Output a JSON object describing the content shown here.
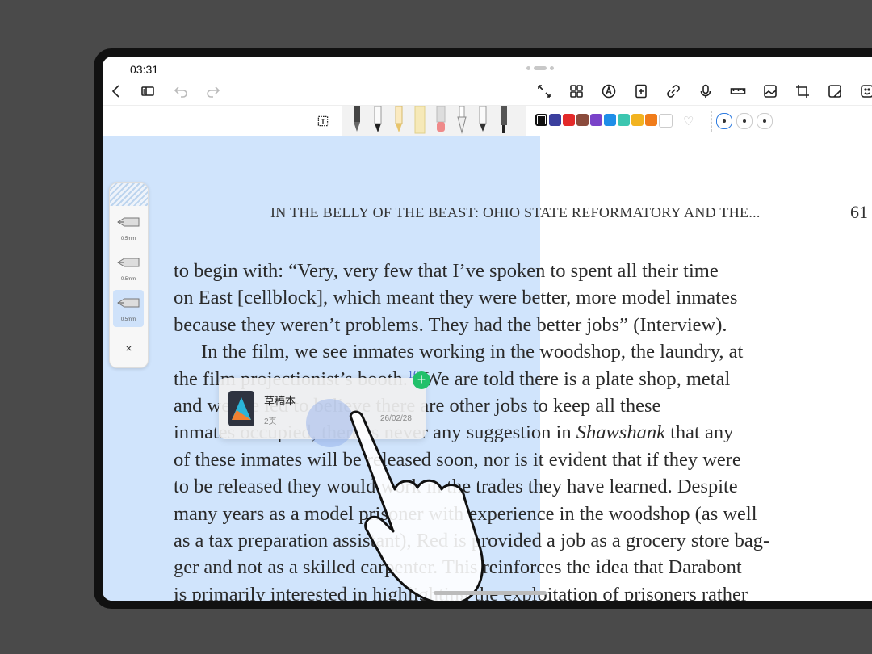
{
  "status": {
    "time": "03:31"
  },
  "topbar": {
    "icons": [
      "back-icon",
      "sidebar-icon",
      "undo-icon",
      "redo-icon",
      "expand-icon",
      "grid-icon",
      "pen-nib-icon",
      "add-page-icon",
      "link-icon",
      "microphone-icon",
      "ruler-icon",
      "image-icon",
      "crop-icon",
      "sticker-icon",
      "emoji-icon"
    ]
  },
  "toolbar": {
    "text_tool_icon": "text-box-icon",
    "tools": [
      "fountain-pen",
      "ballpoint-pen",
      "pencil",
      "highlighter",
      "eraser",
      "brush",
      "marker",
      "fineliner"
    ],
    "colors": [
      "#111111",
      "#3b3f9e",
      "#e32a2a",
      "#8b4b3c",
      "#7a43c9",
      "#1f8ee8",
      "#3cc6b0",
      "#f2b320",
      "#f07c1a",
      "#ffffff"
    ],
    "stroke_sizes": [
      "large",
      "medium",
      "small"
    ]
  },
  "page": {
    "running_head": "IN THE BELLY OF THE BEAST: OHIO STATE REFORMATORY AND THE...",
    "page_number": "61",
    "lines": [
      "to begin with: “Very, very few that I’ve spoken to spent all their time",
      "on East [cellblock], which meant they were better, more model inmates",
      "because they weren’t problems. They had the better jobs” (Interview).",
      "In the film, we see inmates working in the woodshop, the laundry, at",
      "the film projectionist’s booth.",
      "16",
      " We are told there is a plate shop, metal",
      "and we are led to believe there are other jobs to keep all these",
      "inmates occupied, there is never any suggestion in ",
      "Shawshank",
      " that any",
      "of these inmates will be released soon, nor is it evident that if they were",
      "to be released they would work in the trades they have learned. Despite",
      "many years as a model prisoner with experience in the woodshop (as well",
      "as a tax preparation assistant), Red is provided a job as a grocery store bag-",
      "ger and not as a skilled carpenter. This reinforces the idea that Darabont",
      "is primarily interested in highlighting the exploitation of prisoners rather"
    ]
  },
  "pen_panel": {
    "items": [
      {
        "size": "0.5mm",
        "selected": false
      },
      {
        "size": "0.5mm",
        "selected": false
      },
      {
        "size": "0.5mm",
        "selected": true
      }
    ],
    "close": "×"
  },
  "note_card": {
    "title": "草稿本",
    "pages": "2页",
    "date": "26/02/28",
    "add_badge": "+"
  }
}
